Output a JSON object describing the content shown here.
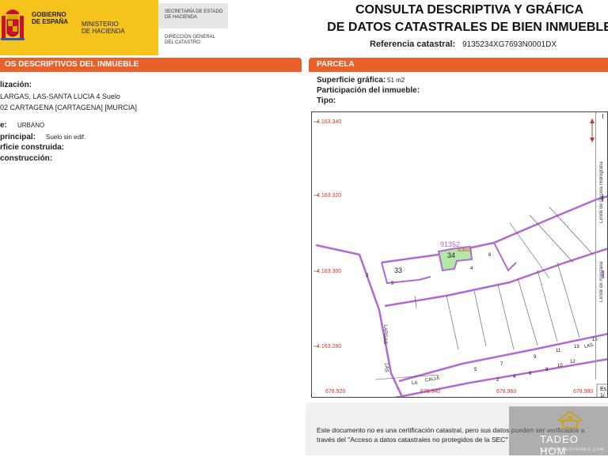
{
  "header": {
    "gobierno": "GOBIERNO\nDE ESPAÑA",
    "ministerio": "MINISTERIO\nDE HACIENDA",
    "secretaria": "SECRETARÍA DE ESTADO\nDE HACIENDA",
    "direccion": "DIRECCIÓN GENERAL\nDEL CATASTRO",
    "title_line1": "CONSULTA DESCRIPTIVA Y GRÁFICA",
    "title_line2": "DE DATOS CATASTRALES DE BIEN INMUEBLE",
    "ref_label": "Referencia catastral:",
    "ref_value": "9135234XG7693N0001DX"
  },
  "left_panel": {
    "bar": "OS DESCRIPTIVOS DEL INMUEBLE",
    "loc_label": "lización:",
    "loc_line1": "LARGAS, LAS-SANTA LUCIA 4 Suelo",
    "loc_line2": "02 CARTAGENA [CARTAGENA] [MURCIA]",
    "clase_label": "e:",
    "clase_value": "URBANO",
    "uso_label": "principal:",
    "uso_value": "Suelo sin edif.",
    "sup_label": "rficie construida:",
    "anio_label": "construcción:"
  },
  "right_panel": {
    "bar": "PARCELA",
    "sup_label": "Superficie gráfica:",
    "sup_value": "51 m2",
    "part_label": "Participación del inmueble:",
    "tipo_label": "Tipo:"
  },
  "map": {
    "y_ticks": [
      "4.163.340",
      "4.163.320",
      "4.163.300",
      "4.163.280"
    ],
    "x_ticks": [
      "678.920",
      "678.940",
      "678.960",
      "678.980"
    ],
    "parcel_id": "91352",
    "parcel_num": "34",
    "suelo": "SUELO",
    "lot_33": "33",
    "street_largas": "LARGAS",
    "street_las": "LAS",
    "street_calle": "CALLE",
    "street_la": "LA",
    "street_las2": "LAS",
    "nums": [
      "2",
      "4",
      "5",
      "6",
      "5",
      "7",
      "9",
      "11",
      "13",
      "15",
      "2",
      "4",
      "6",
      "8",
      "10",
      "12"
    ],
    "legend_1": "Hidrografía",
    "legend_2": "Límite de parcela",
    "legend_3": "Límite de manzana",
    "scale_lbl": "Es",
    "scale_val": "1/"
  },
  "notice": {
    "text": "Este documento no es una certificación catastral, pero sus datos pueden ser verificados a través del \"Acceso a datos catastrales no protegidos de la SEC\""
  },
  "watermark": {
    "name": "TADEO HOM",
    "sub": "WWW.TADEOHOMES.COM"
  },
  "colors": {
    "accent_orange": "#e8602a",
    "parcel_green": "#b5e6a5",
    "boundary_purple": "#b06ad0",
    "header_yellow": "#f6c31c"
  }
}
